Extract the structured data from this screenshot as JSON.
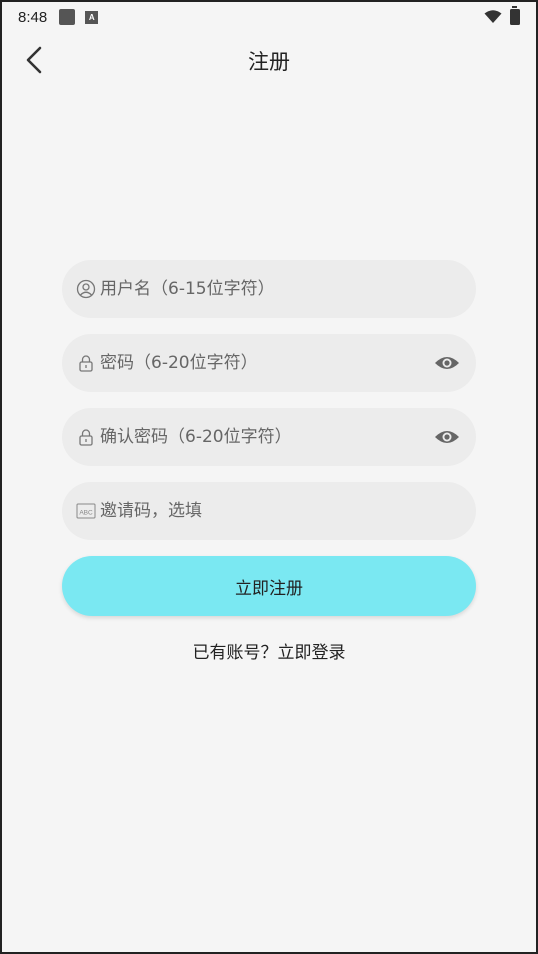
{
  "status_bar": {
    "time": "8:48",
    "a_badge": "A"
  },
  "header": {
    "title": "注册"
  },
  "form": {
    "username_placeholder": "用户名（6-15位字符）",
    "password_placeholder": "密码（6-20位字符）",
    "confirm_placeholder": "确认密码（6-20位字符）",
    "invite_placeholder": "邀请码，选填",
    "invite_icon_text": "ABC",
    "submit_label": "立即注册",
    "login_prompt": "已有账号？立即登录"
  },
  "colors": {
    "background": "#f5f5f5",
    "field_bg": "#ececec",
    "accent": "#7ae8f2"
  }
}
